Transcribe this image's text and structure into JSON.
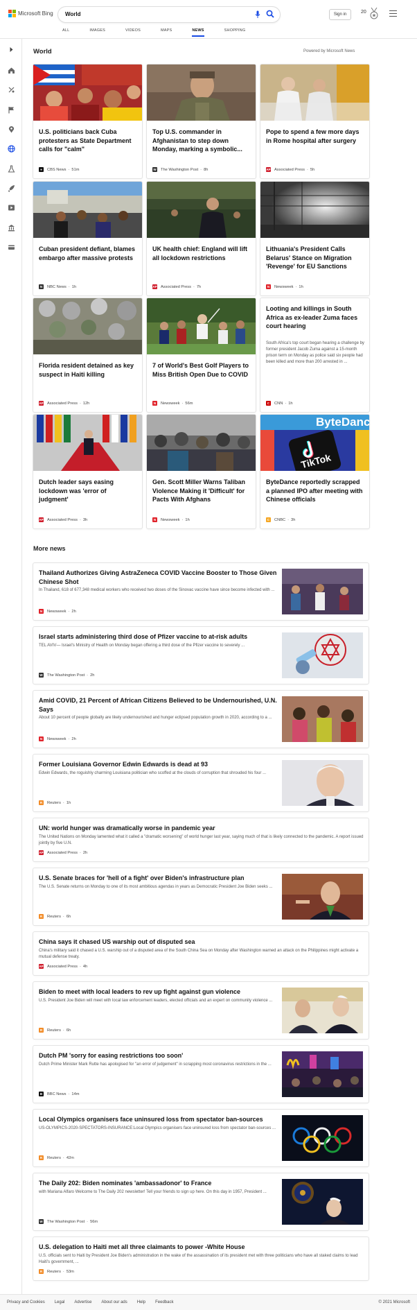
{
  "header": {
    "logo_text": "Microsoft Bing",
    "search_value": "World",
    "signin_label": "Sign in",
    "rewards_count": "20",
    "tabs": [
      {
        "label": "ALL"
      },
      {
        "label": "IMAGES"
      },
      {
        "label": "VIDEOS"
      },
      {
        "label": "MAPS"
      },
      {
        "label": "NEWS"
      },
      {
        "label": "SHOPPING"
      }
    ],
    "active_tab": "NEWS"
  },
  "sidebar": {
    "items": [
      "expand-icon",
      "home-icon",
      "sports-icon",
      "flag-icon",
      "pin-icon",
      "globe-icon",
      "science-icon",
      "rocket-icon",
      "film-icon",
      "bank-icon",
      "card-icon"
    ]
  },
  "top": {
    "title": "World",
    "powered": "Powered by Microsoft News",
    "cards": [
      {
        "title": "U.S. politicians back Cuba protesters as State Department calls for \"calm\"",
        "source": "CBS News",
        "time": "51m",
        "logo": "CBS",
        "logo_color": "#111"
      },
      {
        "title": "Top U.S. commander in Afghanistan to step down Monday, marking a symbolic...",
        "source": "The Washington Post",
        "time": "8h",
        "logo": "W",
        "logo_color": "#333"
      },
      {
        "title": "Pope to spend a few more days in Rome hospital after surgery",
        "source": "Associated Press",
        "time": "5h",
        "logo": "AP",
        "logo_color": "#d01e2d"
      },
      {
        "title": "Cuban president defiant, blames embargo after massive protests",
        "source": "NBC News",
        "time": "1h",
        "logo": "N",
        "logo_color": "#333"
      },
      {
        "title": "UK health chief: England will lift all lockdown restrictions",
        "source": "Associated Press",
        "time": "7h",
        "logo": "AP",
        "logo_color": "#d01e2d"
      },
      {
        "title": "Lithuania's President Calls Belarus' Stance on Migration 'Revenge' for EU Sanctions",
        "source": "Newsweek",
        "time": "1h",
        "logo": "N",
        "logo_color": "#e0232b"
      },
      {
        "title": "Florida resident detained as key suspect in Haiti killing",
        "source": "Associated Press",
        "time": "12h",
        "logo": "AP",
        "logo_color": "#d01e2d"
      },
      {
        "title": "7 of World's Best Golf Players to Miss British Open Due to COVID",
        "source": "Newsweek",
        "time": "56m",
        "logo": "N",
        "logo_color": "#e0232b"
      },
      {
        "title": "Looting and killings in South Africa as ex-leader Zuma faces court hearing",
        "desc": "South Africa's top court began hearing a challenge by former president Jacob Zuma against a 15-month prison term on Monday as police said six people had been killed and more than 200 arrested in ...",
        "source": "CNN",
        "time": "1h",
        "logo": "CNN",
        "logo_color": "#cc0000"
      },
      {
        "title": "Dutch leader says easing lockdown was 'error of judgment'",
        "source": "Associated Press",
        "time": "3h",
        "logo": "AP",
        "logo_color": "#d01e2d"
      },
      {
        "title": "Gen. Scott Miller Warns Taliban Violence Making it 'Difficult' for Pacts With Afghans",
        "source": "Newsweek",
        "time": "1h",
        "logo": "N",
        "logo_color": "#e0232b"
      },
      {
        "title": "ByteDance reportedly scrapped a planned IPO after meeting with Chinese officials",
        "source": "CNBC",
        "time": "3h",
        "logo": "C",
        "logo_color": "#f5a623"
      }
    ],
    "bytedance_img_text": "ByteDance",
    "tiktok_img_text": "TikTok"
  },
  "more": {
    "title": "More news",
    "items": [
      {
        "title": "Thailand Authorizes Giving AstraZeneca COVID Vaccine Booster to Those Given Chinese Shot",
        "desc": "In Thailand, 618 of 677,348 medical workers who received two doses of the Sinovac vaccine have since become infected with ...",
        "source": "Newsweek",
        "time": "2h",
        "logo": "N",
        "logo_color": "#e0232b"
      },
      {
        "title": "Israel starts administering third dose of Pfizer vaccine to at-risk adults",
        "desc": "TEL AVIV— Israel's Ministry of Health on Monday began offering a third dose of the Pfizer vaccine to severely ...",
        "source": "The Washington Post",
        "time": "2h",
        "logo": "W",
        "logo_color": "#333"
      },
      {
        "title": "Amid COVID, 21 Percent of African Citizens Believed to be Undernourished, U.N. Says",
        "desc": "About 10 percent of people globally are likely undernourished and hunger eclipsed population growth in 2020, according to a ...",
        "source": "Newsweek",
        "time": "2h",
        "logo": "N",
        "logo_color": "#e0232b"
      },
      {
        "title": "Former Louisiana Governor Edwin Edwards is dead at 93",
        "desc": "Edwin Edwards, the roguishly charming Louisiana politician who scoffed at the clouds of corruption that shrouded his four ...",
        "source": "Reuters",
        "time": "1h",
        "logo": "R",
        "logo_color": "#f28c28"
      },
      {
        "title": "UN: world hunger was dramatically worse in pandemic year",
        "desc": "The United Nations on Monday lamented what it called a \"dramatic worsening\" of world hunger last year, saying much of that is likely connected to the pandemic. A report issued jointly by five U.N.",
        "source": "Associated Press",
        "time": "2h",
        "logo": "AP",
        "logo_color": "#d01e2d"
      },
      {
        "title": "U.S. Senate braces for 'hell of a fight' over Biden's infrastructure plan",
        "desc": "The U.S. Senate returns on Monday to one of its most ambitious agendas in years as Democratic President Joe Biden seeks ...",
        "source": "Reuters",
        "time": "6h",
        "logo": "R",
        "logo_color": "#f28c28"
      },
      {
        "title": "China says it chased US warship out of disputed sea",
        "desc": "China's military said it chased a U.S. warship out of a disputed area of the South China Sea on Monday after Washington warned an attack on the Philippines might activate a mutual defense treaty.",
        "source": "Associated Press",
        "time": "4h",
        "logo": "AP",
        "logo_color": "#d01e2d"
      },
      {
        "title": "Biden to meet with local leaders to rev up fight against gun violence",
        "desc": "U.S. President Joe Biden will meet with local law enforcement leaders, elected officials and an expert on community violence ...",
        "source": "Reuters",
        "time": "6h",
        "logo": "R",
        "logo_color": "#f28c28"
      },
      {
        "title": "Dutch PM 'sorry for easing restrictions too soon'",
        "desc": "Dutch Prime Minister Mark Rutte has apologised for \"an error of judgement\" in scrapping most coronavirus restrictions in the ...",
        "source": "BBC News",
        "time": "14m",
        "logo": "BBC",
        "logo_color": "#111"
      },
      {
        "title": "Local Olympics organisers face uninsured loss from spectator ban-sources",
        "desc": "US-OLYMPICS-2020-SPECTATORS-INSURANCE:Local Olympics organisers face uninsured loss from spectator ban-sources ...",
        "source": "Reuters",
        "time": "42m",
        "logo": "R",
        "logo_color": "#f28c28"
      },
      {
        "title": "The Daily 202: Biden nominates 'ambassadonor' to France",
        "desc": "with Mariana Alfaro Welcome to The Daily 202 newsletter! Tell your friends to sign up here. On this day in 1957, President ...",
        "source": "The Washington Post",
        "time": "56m",
        "logo": "W",
        "logo_color": "#333"
      },
      {
        "title": "U.S. delegation to Haiti met all three claimants to power -White House",
        "desc": "U.S. officials sent to Haiti by President Joe Biden's administration in the wake of the assassination of its president met with three politicians who have all staked claims to lead Haiti's government, ...",
        "source": "Reuters",
        "time": "53m",
        "logo": "R",
        "logo_color": "#f28c28"
      }
    ]
  },
  "footer": {
    "links": [
      "Privacy and Cookies",
      "Legal",
      "Advertise",
      "About our ads",
      "Help",
      "Feedback"
    ],
    "copyright": "© 2021 Microsoft"
  },
  "colors": {
    "accent": "#174ae4",
    "card_border": "#e3e3e3"
  }
}
